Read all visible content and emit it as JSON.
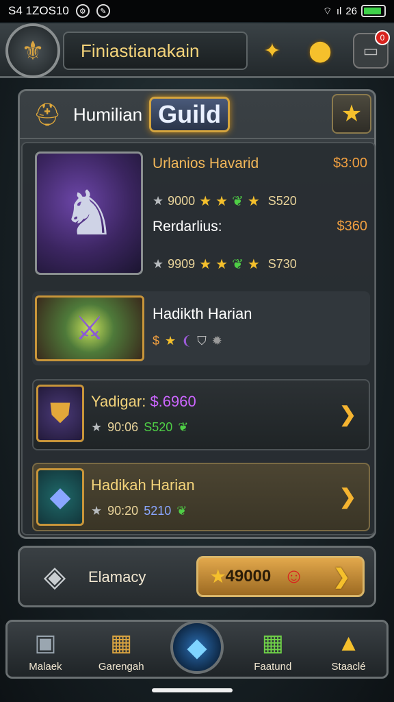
{
  "status_bar": {
    "time": "S4 1ZOS10",
    "wifi_signal": "ıl",
    "clock": "26"
  },
  "header": {
    "title": "Finiastianakain",
    "notification_count": "0"
  },
  "guild": {
    "name": "Humilian",
    "badge": "Guild"
  },
  "hero_rows": [
    {
      "title": "Urlanios Havarid",
      "price": "$3:00",
      "power": "9000",
      "value": "S520"
    },
    {
      "title": "Rerdarlius:",
      "price": "$360",
      "power": "9909",
      "value": "S730"
    }
  ],
  "items": [
    {
      "name": "Hadikth Harian",
      "meta_price": "$"
    },
    {
      "name": "Yadigar:",
      "price": "$.6960",
      "power": "90:06",
      "value": "S520"
    },
    {
      "name": "Hadikah Harian",
      "power": "90:20",
      "value": "5210"
    }
  ],
  "bottom": {
    "label": "Elamacy",
    "buy_amount": "49000"
  },
  "nav": [
    {
      "label": "Malaek",
      "icon": "cube-icon"
    },
    {
      "label": "Garengah",
      "icon": "chest-icon"
    },
    {
      "label": "Faatund",
      "icon": "chest-green-icon"
    },
    {
      "label": "Staaclé",
      "icon": "triangle-icon"
    }
  ],
  "colors": {
    "gold": "#f5c02c",
    "accent_orange": "#f2a040",
    "purple": "#cc66ff",
    "green": "#4fcf46"
  }
}
